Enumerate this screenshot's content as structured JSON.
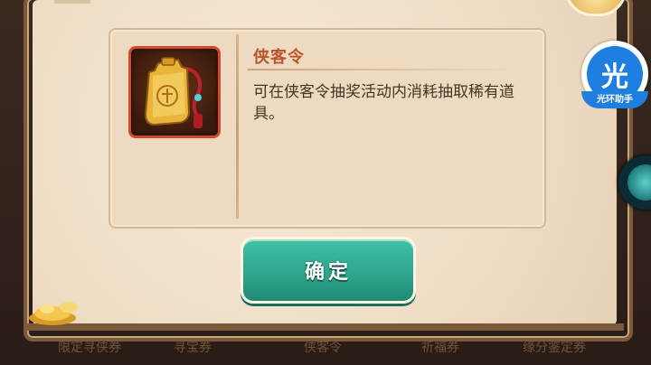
{
  "dialog": {
    "item_name": "侠客令",
    "description": "可在侠客令抽奖活动内消耗抽取稀有道具。",
    "confirm_label": "确定"
  },
  "bottom_tabs": [
    {
      "label": "限定寻侠券"
    },
    {
      "label": "寻宝券"
    },
    {
      "label": "侠客令"
    },
    {
      "label": "祈福券"
    },
    {
      "label": "缘分鉴定券"
    }
  ],
  "overlay": {
    "helper_icon_char": "光",
    "helper_label": "光环助手"
  },
  "colors": {
    "title": "#b8572d",
    "confirm_button": "#2fa68e",
    "icon_border": "#d14a2a"
  }
}
